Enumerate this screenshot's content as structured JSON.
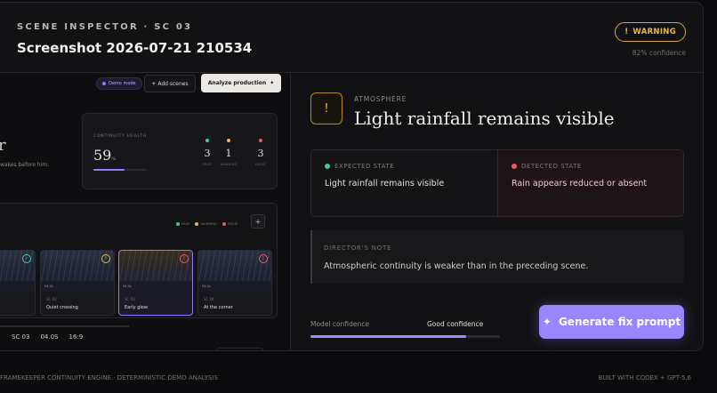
{
  "header": {
    "eyebrow": "SCENE INSPECTOR · SC 03",
    "title": "Screenshot 2026-07-21 210534",
    "badge_icon": "!",
    "badge_label": "WARNING",
    "confidence_text": "82% confidence"
  },
  "preview": {
    "demo_chip": "Demo mode",
    "add_scenes": "+ Add scenes",
    "analyze": "Analyze production",
    "analyze_icon": "✦",
    "hero_text": "r",
    "hero_sub": "wakes before him.",
    "health": {
      "label": "CONTINUITY HEALTH",
      "value": "59",
      "unit": "%",
      "fill_fraction": 0.59,
      "stats": [
        {
          "value": "3",
          "label": "PASS",
          "color": "#3ecf8e"
        },
        {
          "value": "1",
          "label": "WARNING",
          "color": "#e9b84a"
        },
        {
          "value": "3",
          "label": "ISSUE",
          "color": "#ef5a62"
        }
      ]
    },
    "timeline": {
      "legend": [
        {
          "label": "PASS",
          "color": "#3ecf8e"
        },
        {
          "label": "WARNING",
          "color": "#e9b84a"
        },
        {
          "label": "ISSUE",
          "color": "#ef5a62"
        }
      ],
      "add_icon": "+",
      "scenes": [
        {
          "num": "",
          "name": "",
          "time": "",
          "badge": "✓",
          "badge_color": "#3ecf8e"
        },
        {
          "num": "SC 02",
          "name": "Quiet crossing",
          "time": "04.2s",
          "badge": "!",
          "badge_color": "#e9b84a"
        },
        {
          "num": "SC 03",
          "name": "Early glow",
          "time": "04.0s",
          "badge": "!",
          "badge_color": "#ef5a62"
        },
        {
          "num": "SC 04",
          "name": "At the corner",
          "time": "04.2s",
          "badge": "!",
          "badge_color": "#ef5a62"
        }
      ]
    },
    "footer": {
      "scene": "SC 03",
      "duration": "04.0S",
      "ratio": "16:9"
    }
  },
  "detail": {
    "alert_icon": "!",
    "category": "ATMOSPHERE",
    "title": "Light rainfall remains visible",
    "expected_label": "EXPECTED STATE",
    "expected_text": "Light rainfall remains visible",
    "detected_label": "DETECTED STATE",
    "detected_text": "Rain appears reduced or absent",
    "note_label": "DIRECTOR'S NOTE",
    "note_text": "Atmospheric continuity is weaker than in the preceding scene.",
    "confidence_label": "Model confidence",
    "confidence_value": "Good confidence",
    "confidence_fraction": 0.82,
    "generate_icon": "✦",
    "generate_label": "Generate fix prompt"
  },
  "footer": {
    "left": "FRAMEKEEPER CONTINUITY ENGINE · DETERMINISTIC DEMO ANALYSIS",
    "right": "BUILT WITH CODEX + GPT-5.6"
  },
  "colors": {
    "accent": "#9a86ff",
    "warning": "#e9b84a",
    "pass": "#3ecf8e",
    "issue": "#ef5a62"
  }
}
